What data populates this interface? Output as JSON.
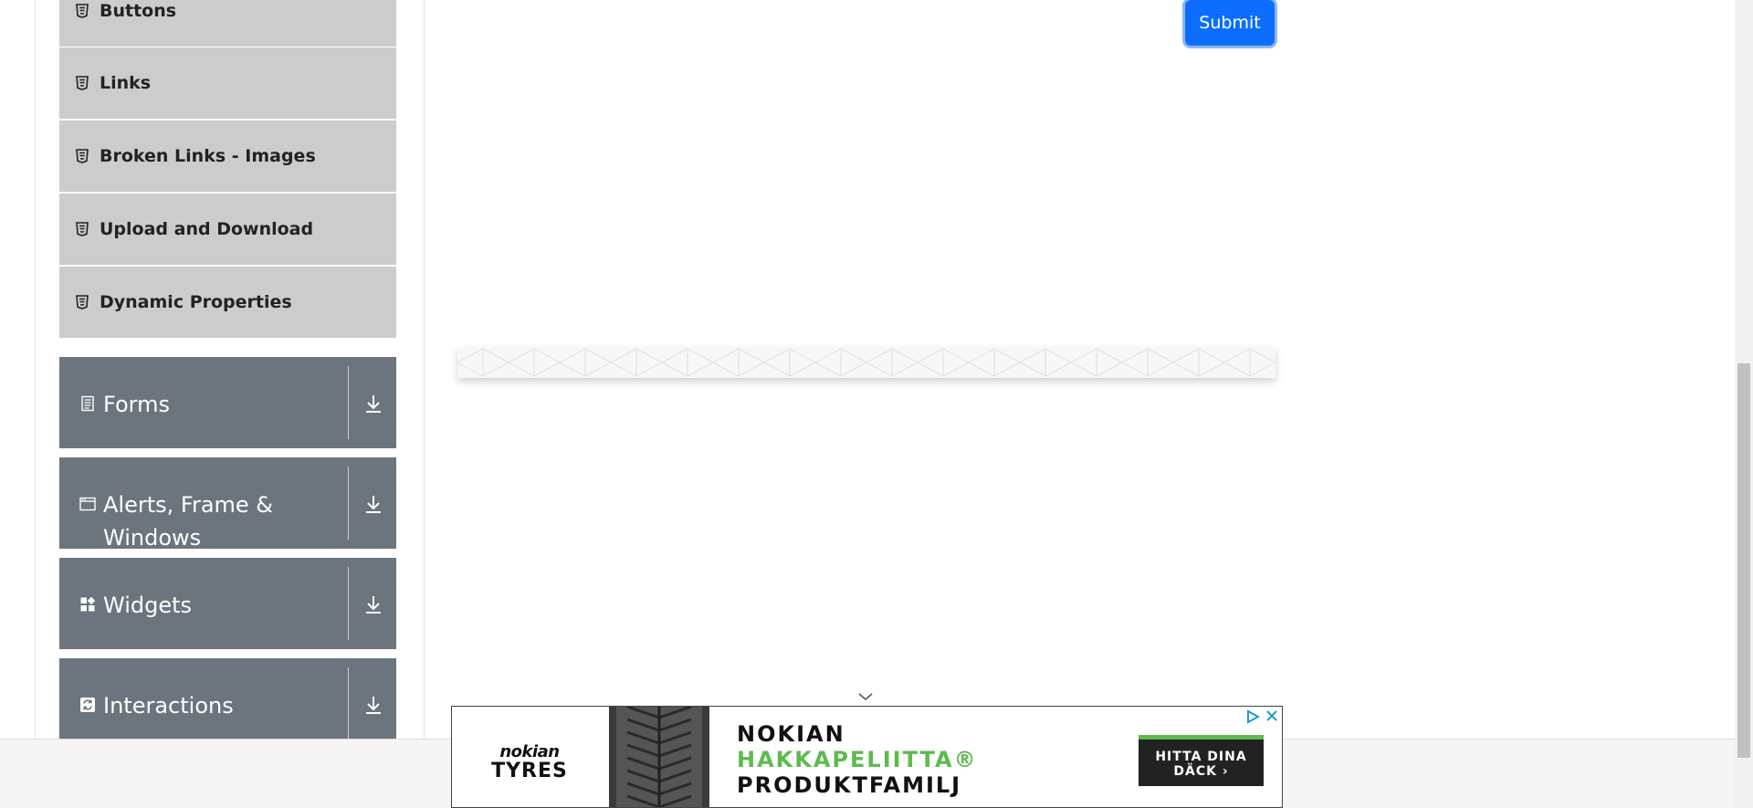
{
  "sidebar": {
    "sub_items": [
      {
        "label": "Buttons",
        "icon": "html5-icon"
      },
      {
        "label": "Links",
        "icon": "html5-icon"
      },
      {
        "label": "Broken Links - Images",
        "icon": "html5-icon"
      },
      {
        "label": "Upload and Download",
        "icon": "html5-icon"
      },
      {
        "label": "Dynamic Properties",
        "icon": "html5-icon"
      }
    ],
    "groups": [
      {
        "label": "Forms",
        "icon": "form-icon"
      },
      {
        "label": "Alerts, Frame & Windows",
        "icon": "window-icon"
      },
      {
        "label": "Widgets",
        "icon": "widgets-icon"
      },
      {
        "label": "Interactions",
        "icon": "interactions-icon"
      }
    ]
  },
  "main": {
    "submit_label": "Submit"
  },
  "ad": {
    "brand_line1": "nokian",
    "brand_line2": "TYRES",
    "headline1": "NOKIAN",
    "headline2": "HAKKAPELIITTA®",
    "headline3": "PRODUKTFAMILJ",
    "cta": "HITTA DINA DÄCK ›",
    "colors": {
      "accent": "#5dbb4d",
      "cta_bg": "#222222"
    }
  },
  "colors": {
    "sub_item_bg": "#cccccc",
    "group_bg": "#6c757d",
    "primary": "#0d6efd"
  }
}
